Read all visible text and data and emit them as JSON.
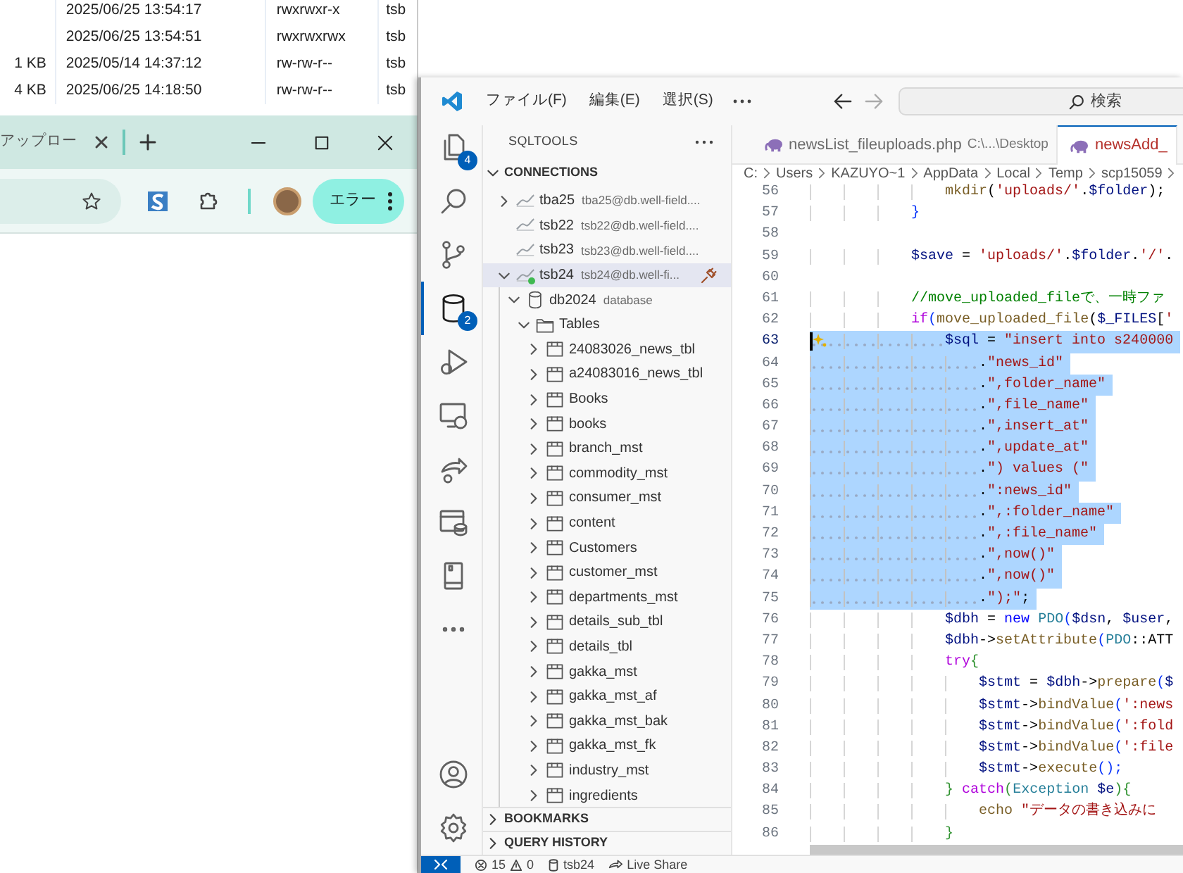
{
  "file_list": {
    "rows": [
      {
        "date": "2025/06/25 13:54:17",
        "permissions": "rwxrwxr-x",
        "owner": "tsb"
      },
      {
        "date": "2025/06/25 13:54:51",
        "permissions": "rwxrwxrwx",
        "owner": "tsb"
      },
      {
        "size": "1 KB",
        "date": "2025/05/14 14:37:12",
        "permissions": "rw-rw-r--",
        "owner": "tsb"
      },
      {
        "size": "4 KB",
        "date": "2025/06/25 14:18:50",
        "permissions": "rw-rw-r--",
        "owner": "tsb"
      }
    ]
  },
  "browser": {
    "tab": {
      "title": "アップロー"
    },
    "profile_button": "エラー"
  },
  "vscode": {
    "menu": [
      "ファイル(F)",
      "編集(E)",
      "選択(S)"
    ],
    "search": {
      "placeholder": "検索"
    },
    "activity_bar": {
      "top": [
        {
          "kind": "files",
          "badge": "4",
          "selected": false
        },
        {
          "kind": "search",
          "selected": false
        },
        {
          "kind": "source-control",
          "selected": false
        },
        {
          "kind": "database",
          "badge": "2",
          "selected": true
        },
        {
          "kind": "run-debug",
          "selected": false
        },
        {
          "kind": "remote",
          "selected": false
        },
        {
          "kind": "live-share",
          "selected": false
        },
        {
          "kind": "panel",
          "selected": false
        },
        {
          "kind": "book",
          "selected": false
        },
        {
          "kind": "more",
          "selected": false
        }
      ],
      "bottom": [
        {
          "kind": "account"
        },
        {
          "kind": "settings"
        }
      ]
    },
    "sidebar": {
      "title": "SQLTOOLS",
      "sections": [
        {
          "title": "CONNECTIONS",
          "expanded": true,
          "tree": [
            {
              "kind": "connection",
              "label": "tba25",
              "detail": "tba25@db.well-field....",
              "expanded": false,
              "selected": false,
              "connected": false
            },
            {
              "kind": "connection",
              "label": "tsb22",
              "detail": "tsb22@db.well-field....",
              "selected": false,
              "connected": false
            },
            {
              "kind": "connection",
              "label": "tsb23",
              "detail": "tsb23@db.well-field....",
              "selected": false,
              "connected": false
            },
            {
              "kind": "connection",
              "label": "tsb24",
              "detail": "tsb24@db.well-fi...",
              "expanded": true,
              "selected": true,
              "connected": true,
              "children": [
                {
                  "kind": "database",
                  "label": "db2024",
                  "detail": "database",
                  "expanded": true,
                  "selected": false,
                  "children": [
                    {
                      "kind": "folder",
                      "label": "Tables",
                      "expanded": true,
                      "selected": false,
                      "children": [
                        {
                          "kind": "table",
                          "label": "24083026_news_tbl",
                          "expanded": false,
                          "selected": false
                        },
                        {
                          "kind": "table",
                          "label": "a24083016_news_tbl",
                          "expanded": false,
                          "selected": false
                        },
                        {
                          "kind": "table",
                          "label": "Books",
                          "expanded": false,
                          "selected": false
                        },
                        {
                          "kind": "table",
                          "label": "books",
                          "expanded": false,
                          "selected": false
                        },
                        {
                          "kind": "table",
                          "label": "branch_mst",
                          "expanded": false,
                          "selected": false
                        },
                        {
                          "kind": "table",
                          "label": "commodity_mst",
                          "expanded": false,
                          "selected": false
                        },
                        {
                          "kind": "table",
                          "label": "consumer_mst",
                          "expanded": false,
                          "selected": false
                        },
                        {
                          "kind": "table",
                          "label": "content",
                          "expanded": false,
                          "selected": false
                        },
                        {
                          "kind": "table",
                          "label": "Customers",
                          "expanded": false,
                          "selected": false
                        },
                        {
                          "kind": "table",
                          "label": "customer_mst",
                          "expanded": false,
                          "selected": false
                        },
                        {
                          "kind": "table",
                          "label": "departments_mst",
                          "expanded": false,
                          "selected": false
                        },
                        {
                          "kind": "table",
                          "label": "details_sub_tbl",
                          "expanded": false,
                          "selected": false
                        },
                        {
                          "kind": "table",
                          "label": "details_tbl",
                          "expanded": false,
                          "selected": false
                        },
                        {
                          "kind": "table",
                          "label": "gakka_mst",
                          "expanded": false,
                          "selected": false
                        },
                        {
                          "kind": "table",
                          "label": "gakka_mst_af",
                          "expanded": false,
                          "selected": false
                        },
                        {
                          "kind": "table",
                          "label": "gakka_mst_bak",
                          "expanded": false,
                          "selected": false
                        },
                        {
                          "kind": "table",
                          "label": "gakka_mst_fk",
                          "expanded": false,
                          "selected": false
                        },
                        {
                          "kind": "table",
                          "label": "industry_mst",
                          "expanded": false,
                          "selected": false
                        },
                        {
                          "kind": "table",
                          "label": "ingredients",
                          "expanded": false,
                          "selected": false
                        }
                      ]
                    }
                  ]
                }
              ]
            }
          ]
        },
        {
          "title": "BOOKMARKS",
          "expanded": false
        },
        {
          "title": "QUERY HISTORY",
          "expanded": false
        }
      ]
    },
    "tabs": [
      {
        "label": "newsList_fileuploads.php",
        "detail": "C:\\...\\Desktop",
        "selected": false,
        "has_errors": false
      },
      {
        "label": "newsAdd_",
        "selected": true,
        "has_errors": true
      }
    ],
    "breadcrumb": [
      "C:",
      "Users",
      "KAZUYO~1",
      "AppData",
      "Local",
      "Temp",
      "scp15059"
    ],
    "code": {
      "lines": [
        {
          "number": "56",
          "selected": false,
          "active": false,
          "tokens": [
            {
              "kind": "function",
              "text": "                mkdir"
            },
            {
              "kind": "plain",
              "text": "("
            },
            {
              "kind": "string",
              "text": "'uploads/'"
            },
            {
              "kind": "plain",
              "text": "."
            },
            {
              "kind": "variable",
              "text": "$folder"
            },
            {
              "kind": "plain",
              "text": ");"
            }
          ]
        },
        {
          "number": "57",
          "selected": false,
          "active": false,
          "tokens": [
            {
              "kind": "bracket",
              "text": "            }"
            }
          ]
        },
        {
          "number": "58",
          "selected": false,
          "active": false
        },
        {
          "number": "59",
          "selected": false,
          "active": false,
          "tokens": [
            {
              "kind": "variable",
              "text": "            $save"
            },
            {
              "kind": "plain",
              "text": " = "
            },
            {
              "kind": "string",
              "text": "'uploads/'"
            },
            {
              "kind": "plain",
              "text": "."
            },
            {
              "kind": "variable",
              "text": "$folder"
            },
            {
              "kind": "plain",
              "text": "."
            },
            {
              "kind": "string",
              "text": "'/'"
            },
            {
              "kind": "plain",
              "text": "."
            }
          ]
        },
        {
          "number": "60",
          "selected": false,
          "active": false
        },
        {
          "number": "61",
          "selected": false,
          "active": false,
          "tokens": [
            {
              "kind": "comment",
              "text": "            //move_uploaded_fileで、一時ファ"
            }
          ]
        },
        {
          "number": "62",
          "selected": false,
          "active": false,
          "tokens": [
            {
              "kind": "keyword",
              "text": "            if"
            },
            {
              "kind": "bracket",
              "text": "("
            },
            {
              "kind": "function",
              "text": "move_uploaded_file"
            },
            {
              "kind": "plain",
              "text": "("
            },
            {
              "kind": "variable",
              "text": "$_FILES"
            },
            {
              "kind": "plain",
              "text": "["
            },
            {
              "kind": "string",
              "text": "'"
            }
          ]
        },
        {
          "number": "63",
          "selected": true,
          "active": true,
          "tokens": [
            {
              "kind": "variable",
              "text": "                $sql"
            },
            {
              "kind": "plain",
              "text": " = "
            },
            {
              "kind": "string",
              "text": "\"insert into s240000"
            }
          ]
        },
        {
          "number": "64",
          "selected": true,
          "active": false,
          "tokens": [
            {
              "kind": "plain",
              "text": "                    ."
            },
            {
              "kind": "string",
              "text": "\"news_id\""
            }
          ]
        },
        {
          "number": "65",
          "selected": true,
          "active": false,
          "tokens": [
            {
              "kind": "plain",
              "text": "                    ."
            },
            {
              "kind": "string",
              "text": "\",folder_name\""
            }
          ]
        },
        {
          "number": "66",
          "selected": true,
          "active": false,
          "tokens": [
            {
              "kind": "plain",
              "text": "                    ."
            },
            {
              "kind": "string",
              "text": "\",file_name\""
            }
          ]
        },
        {
          "number": "67",
          "selected": true,
          "active": false,
          "tokens": [
            {
              "kind": "plain",
              "text": "                    ."
            },
            {
              "kind": "string",
              "text": "\",insert_at\""
            }
          ]
        },
        {
          "number": "68",
          "selected": true,
          "active": false,
          "tokens": [
            {
              "kind": "plain",
              "text": "                    ."
            },
            {
              "kind": "string",
              "text": "\",update_at\""
            }
          ]
        },
        {
          "number": "69",
          "selected": true,
          "active": false,
          "tokens": [
            {
              "kind": "plain",
              "text": "                    ."
            },
            {
              "kind": "string",
              "text": "\") values (\""
            }
          ]
        },
        {
          "number": "70",
          "selected": true,
          "active": false,
          "tokens": [
            {
              "kind": "plain",
              "text": "                    ."
            },
            {
              "kind": "string",
              "text": "\":news_id\""
            }
          ]
        },
        {
          "number": "71",
          "selected": true,
          "active": false,
          "tokens": [
            {
              "kind": "plain",
              "text": "                    ."
            },
            {
              "kind": "string",
              "text": "\",:folder_name\""
            }
          ]
        },
        {
          "number": "72",
          "selected": true,
          "active": false,
          "tokens": [
            {
              "kind": "plain",
              "text": "                    ."
            },
            {
              "kind": "string",
              "text": "\",:file_name\""
            }
          ]
        },
        {
          "number": "73",
          "selected": true,
          "active": false,
          "tokens": [
            {
              "kind": "plain",
              "text": "                    ."
            },
            {
              "kind": "string",
              "text": "\",now()\""
            }
          ]
        },
        {
          "number": "74",
          "selected": true,
          "active": false,
          "tokens": [
            {
              "kind": "plain",
              "text": "                    ."
            },
            {
              "kind": "string",
              "text": "\",now()\""
            }
          ]
        },
        {
          "number": "75",
          "selected": true,
          "active": false,
          "tokens": [
            {
              "kind": "plain",
              "text": "                    ."
            },
            {
              "kind": "string",
              "text": "\");\""
            },
            {
              "kind": "plain",
              "text": ";"
            }
          ]
        },
        {
          "number": "76",
          "selected": false,
          "active": false,
          "tokens": [
            {
              "kind": "variable",
              "text": "                $dbh"
            },
            {
              "kind": "plain",
              "text": " = "
            },
            {
              "kind": "storage",
              "text": "new"
            },
            {
              "kind": "class",
              "text": " PDO"
            },
            {
              "kind": "bracket",
              "text": "("
            },
            {
              "kind": "variable",
              "text": "$dsn"
            },
            {
              "kind": "plain",
              "text": ", "
            },
            {
              "kind": "variable",
              "text": "$user"
            },
            {
              "kind": "plain",
              "text": ","
            }
          ]
        },
        {
          "number": "77",
          "selected": false,
          "active": false,
          "tokens": [
            {
              "kind": "variable",
              "text": "                $dbh"
            },
            {
              "kind": "plain",
              "text": "->"
            },
            {
              "kind": "function",
              "text": "setAttribute"
            },
            {
              "kind": "bracket",
              "text": "("
            },
            {
              "kind": "class",
              "text": "PDO"
            },
            {
              "kind": "plain",
              "text": "::ATT"
            }
          ]
        },
        {
          "number": "78",
          "selected": false,
          "active": false,
          "tokens": [
            {
              "kind": "keyword",
              "text": "                try"
            },
            {
              "kind": "bracket2",
              "text": "{"
            }
          ]
        },
        {
          "number": "79",
          "selected": false,
          "active": false,
          "tokens": [
            {
              "kind": "variable",
              "text": "                    $stmt"
            },
            {
              "kind": "plain",
              "text": " = "
            },
            {
              "kind": "variable",
              "text": "$dbh"
            },
            {
              "kind": "plain",
              "text": "->"
            },
            {
              "kind": "function",
              "text": "prepare"
            },
            {
              "kind": "bracket",
              "text": "("
            },
            {
              "kind": "variable",
              "text": "$"
            }
          ]
        },
        {
          "number": "80",
          "selected": false,
          "active": false,
          "tokens": [
            {
              "kind": "variable",
              "text": "                    $stmt"
            },
            {
              "kind": "plain",
              "text": "->"
            },
            {
              "kind": "function",
              "text": "bindValue"
            },
            {
              "kind": "bracket",
              "text": "("
            },
            {
              "kind": "string",
              "text": "':news"
            }
          ]
        },
        {
          "number": "81",
          "selected": false,
          "active": false,
          "tokens": [
            {
              "kind": "variable",
              "text": "                    $stmt"
            },
            {
              "kind": "plain",
              "text": "->"
            },
            {
              "kind": "function",
              "text": "bindValue"
            },
            {
              "kind": "bracket",
              "text": "("
            },
            {
              "kind": "string",
              "text": "':fold"
            }
          ]
        },
        {
          "number": "82",
          "selected": false,
          "active": false,
          "tokens": [
            {
              "kind": "variable",
              "text": "                    $stmt"
            },
            {
              "kind": "plain",
              "text": "->"
            },
            {
              "kind": "function",
              "text": "bindValue"
            },
            {
              "kind": "bracket",
              "text": "("
            },
            {
              "kind": "string",
              "text": "':file"
            }
          ]
        },
        {
          "number": "83",
          "selected": false,
          "active": false,
          "tokens": [
            {
              "kind": "variable",
              "text": "                    $stmt"
            },
            {
              "kind": "plain",
              "text": "->"
            },
            {
              "kind": "function",
              "text": "execute"
            },
            {
              "kind": "bracket",
              "text": "();"
            }
          ]
        },
        {
          "number": "84",
          "selected": false,
          "active": false,
          "tokens": [
            {
              "kind": "bracket2",
              "text": "                } "
            },
            {
              "kind": "keyword",
              "text": "catch"
            },
            {
              "kind": "bracket2",
              "text": "("
            },
            {
              "kind": "class",
              "text": "Exception"
            },
            {
              "kind": "variable",
              "text": " $e"
            },
            {
              "kind": "bracket2",
              "text": "){"
            }
          ]
        },
        {
          "number": "85",
          "selected": false,
          "active": false,
          "tokens": [
            {
              "kind": "function",
              "text": "                    echo"
            },
            {
              "kind": "string",
              "text": " \"データの書き込みに"
            }
          ]
        },
        {
          "number": "86",
          "selected": false,
          "active": false,
          "tokens": [
            {
              "kind": "bracket2",
              "text": "                }"
            }
          ]
        }
      ]
    },
    "status_bar": {
      "errors": "15",
      "warnings": "0",
      "connection": "tsb24",
      "live_share": "Live Share"
    }
  }
}
